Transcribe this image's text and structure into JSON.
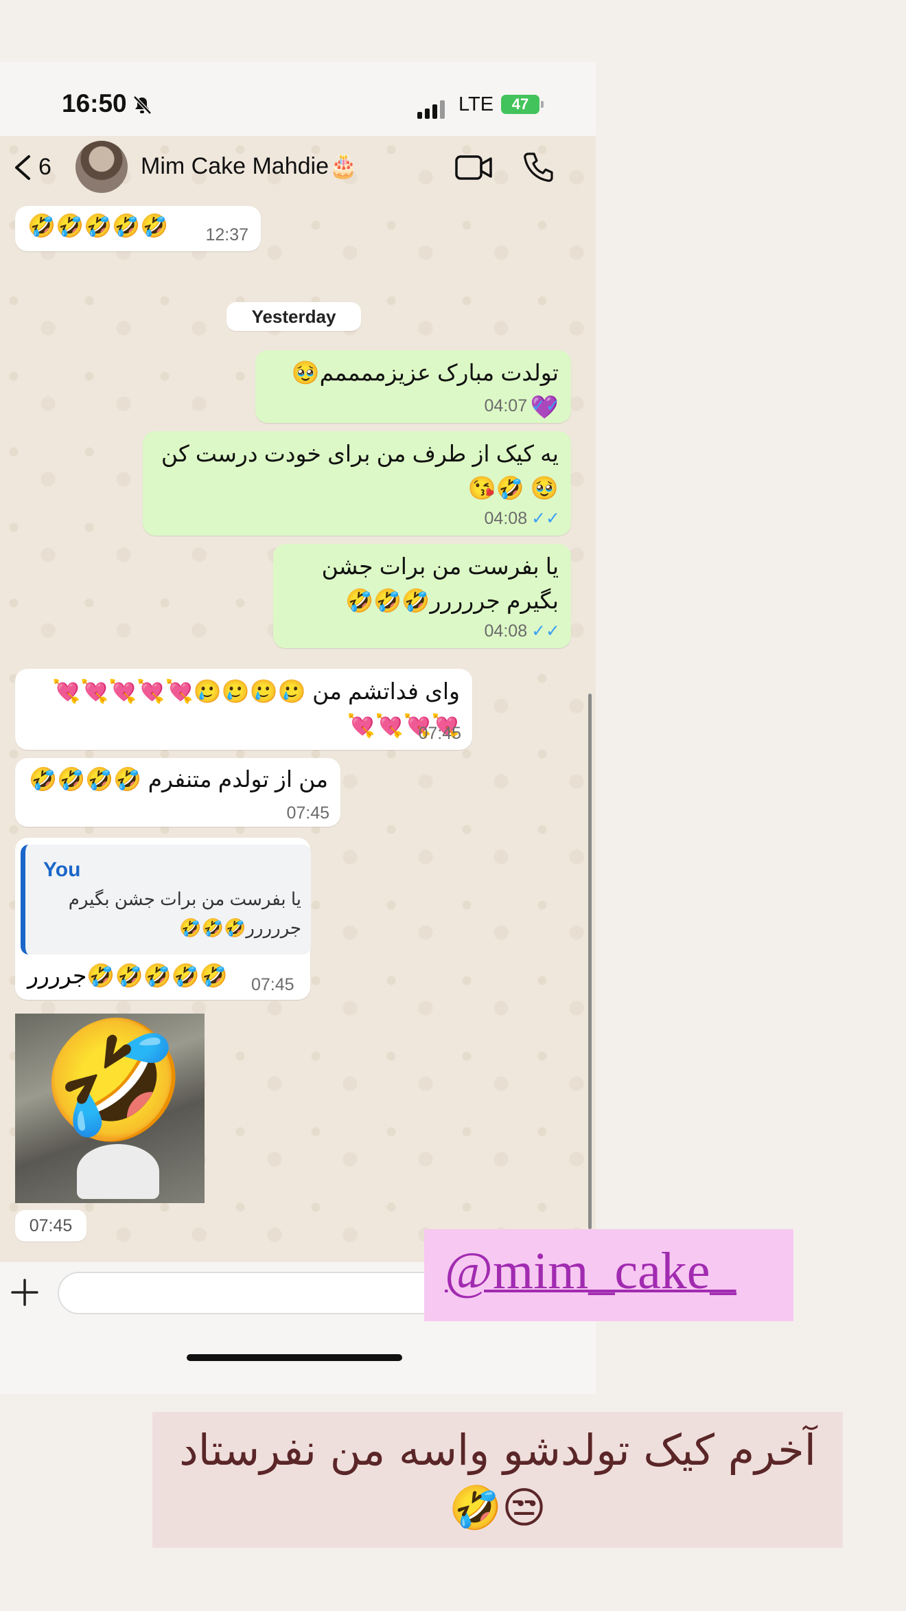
{
  "status_bar": {
    "time": "16:50",
    "network": "LTE",
    "battery": "47"
  },
  "header": {
    "back_count": "6",
    "contact_name": "Mim Cake Mahdie🎂"
  },
  "icons": {
    "back": "chevron-left-icon",
    "video": "video-camera-icon",
    "call": "phone-icon",
    "mute": "bell-slash-icon",
    "plus": "plus-icon"
  },
  "messages": [
    {
      "dir": "in",
      "text": "🤣🤣🤣🤣🤣",
      "time": "12:37"
    },
    {
      "dir": "date",
      "text": "Yesterday"
    },
    {
      "dir": "out",
      "text": "تولدت مبارک عزیزممممم🥹💜",
      "time": "04:07",
      "read": "✓✓"
    },
    {
      "dir": "out",
      "text": "یه کیک از طرف من برای خودت درست کن🥹 🤣😘",
      "time": "04:08",
      "read": "✓✓"
    },
    {
      "dir": "out",
      "text": "یا بفرست من برات جشن بگیرم جررررر🤣🤣🤣",
      "time": "04:08",
      "read": "✓✓"
    },
    {
      "dir": "in",
      "text": "وای فداتشم من 🥲🥲🥲🥲💘💘💘💘💘 💘💘💘💘",
      "time": "07:45"
    },
    {
      "dir": "in",
      "text": "من از تولدم متنفرم 🤣🤣🤣🤣",
      "time": "07:45"
    },
    {
      "dir": "in",
      "reply_author": "You",
      "reply_text": "یا بفرست من برات جشن بگیرم جررررر🤣🤣🤣",
      "text": "جرررر🤣🤣🤣🤣🤣",
      "time": "07:45"
    },
    {
      "dir": "in",
      "type": "photo",
      "emoji": "🤣",
      "time": "07:45"
    }
  ],
  "watermark": "@mim_cake_",
  "caption": "آخرم کیک تولدشو واسه من نفرستاد 😒🤣",
  "colors": {
    "out_bubble": "#dcf8c6",
    "in_bubble": "#ffffff",
    "read_ticks": "#3b9ef5",
    "reply_accent": "#1b66c9"
  }
}
